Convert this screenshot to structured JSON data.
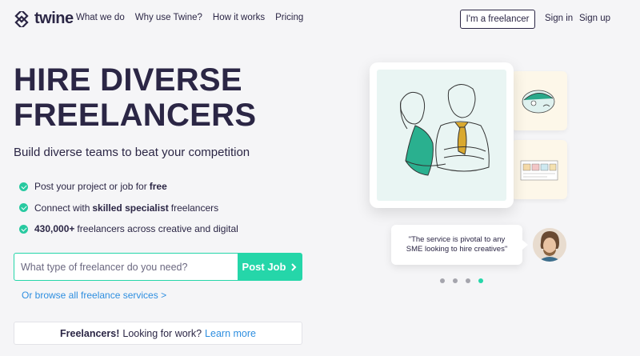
{
  "header": {
    "logo_text": "twine",
    "nav": [
      "What we do",
      "Why use Twine?",
      "How it works",
      "Pricing"
    ],
    "freelancer_button": "I'm a freelancer",
    "sign_in": "Sign in",
    "sign_up": "Sign up"
  },
  "hero": {
    "title_line1": "HIRE DIVERSE",
    "title_line2": "FREELANCERS",
    "subtitle": "Build diverse teams to beat your competition",
    "features": [
      {
        "pre": "Post your project or job for",
        "bold": "free",
        "post": ""
      },
      {
        "pre": "Connect with",
        "bold": "skilled specialist",
        "post": "freelancers"
      },
      {
        "pre": "",
        "bold": "430,000+",
        "post": "freelancers across creative and digital"
      }
    ]
  },
  "search": {
    "placeholder": "What type of freelancer do you need?",
    "button": "Post Job",
    "browse_link": "Or browse all freelance services >"
  },
  "banner": {
    "bold": "Freelancers!",
    "text": "Looking for work?",
    "link": "Learn more"
  },
  "testimonial": {
    "quote_line1": "\"The service is pivotal to any",
    "quote_line2": "SME looking to hire creatives\""
  },
  "carousel": {
    "count": 4,
    "active_index": 3
  },
  "colors": {
    "accent": "#25d6a9",
    "navy": "#2b2645",
    "link": "#2f8fe0"
  }
}
